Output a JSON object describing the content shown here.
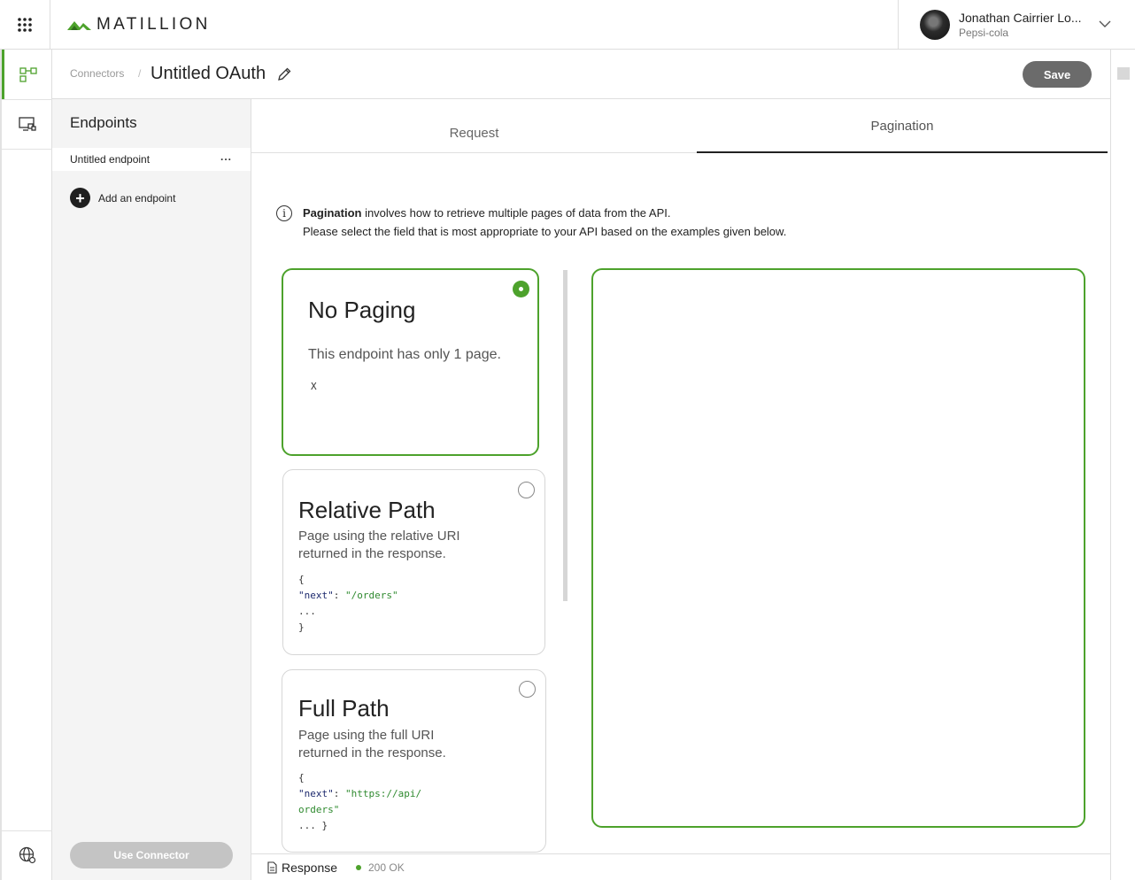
{
  "header": {
    "brand": "MATILLION",
    "user": {
      "name": "Jonathan Cairrier Lo...",
      "org": "Pepsi-cola"
    }
  },
  "subheader": {
    "breadcrumb": "Connectors",
    "separator": "/",
    "title": "Untitled OAuth",
    "save_label": "Save"
  },
  "sidebar": {
    "title": "Endpoints",
    "items": [
      {
        "label": "Untitled endpoint",
        "more": "..."
      }
    ],
    "add_label": "Add an endpoint",
    "use_connector_label": "Use Connector"
  },
  "tabs": [
    {
      "label": "Request",
      "active": false
    },
    {
      "label": "Pagination",
      "active": true
    }
  ],
  "info": {
    "bold": "Pagination",
    "line1_rest": " involves how to retrieve multiple pages of data from the API.",
    "line2": "Please select the field that is most appropriate to your API based on the examples given below."
  },
  "options": [
    {
      "title": "No Paging",
      "description": "This endpoint has only 1 page.",
      "code": "X",
      "selected": true
    },
    {
      "title": "Relative Path",
      "description": "Page using the relative URI returned in the response.",
      "code": {
        "open": "{",
        "key": "\"next\"",
        "colon": ": ",
        "value": "\"/orders\"",
        "ellipsis": "...",
        "close": "}"
      },
      "selected": false
    },
    {
      "title": "Full Path",
      "description": "Page using the full URI returned in the response.",
      "code": {
        "open": "{",
        "key": "\"next\"",
        "colon": ": ",
        "value_line1": "\"https://api/",
        "value_line2": "orders\"",
        "close": "... }"
      },
      "selected": false
    }
  ],
  "status": {
    "response_label": "Response",
    "code": "200 OK"
  },
  "colors": {
    "accent": "#4da22c",
    "save": "#6b6b6b",
    "disabled": "#c4c4c4"
  },
  "icons": {
    "apps": "grid-icon",
    "brand": "matillion-logo-icon",
    "chevron": "chevron-down-icon",
    "connector": "connector-icon",
    "pipeline": "monitor-icon",
    "global": "globe-icon",
    "edit": "pencil-icon",
    "info": "info-icon",
    "add": "plus-icon",
    "response": "document-icon"
  }
}
